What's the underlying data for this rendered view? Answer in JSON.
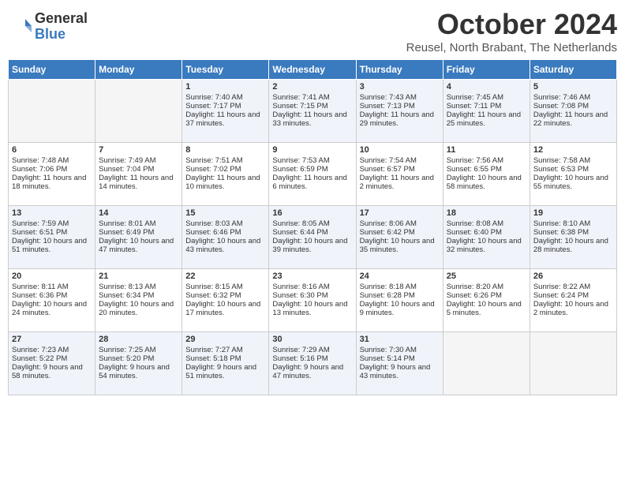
{
  "logo": {
    "general": "General",
    "blue": "Blue"
  },
  "title": "October 2024",
  "location": "Reusel, North Brabant, The Netherlands",
  "days": [
    "Sunday",
    "Monday",
    "Tuesday",
    "Wednesday",
    "Thursday",
    "Friday",
    "Saturday"
  ],
  "weeks": [
    [
      {
        "day": "",
        "empty": true
      },
      {
        "day": "",
        "empty": true
      },
      {
        "day": "1",
        "sunrise": "Sunrise: 7:40 AM",
        "sunset": "Sunset: 7:17 PM",
        "daylight": "Daylight: 11 hours and 37 minutes."
      },
      {
        "day": "2",
        "sunrise": "Sunrise: 7:41 AM",
        "sunset": "Sunset: 7:15 PM",
        "daylight": "Daylight: 11 hours and 33 minutes."
      },
      {
        "day": "3",
        "sunrise": "Sunrise: 7:43 AM",
        "sunset": "Sunset: 7:13 PM",
        "daylight": "Daylight: 11 hours and 29 minutes."
      },
      {
        "day": "4",
        "sunrise": "Sunrise: 7:45 AM",
        "sunset": "Sunset: 7:11 PM",
        "daylight": "Daylight: 11 hours and 25 minutes."
      },
      {
        "day": "5",
        "sunrise": "Sunrise: 7:46 AM",
        "sunset": "Sunset: 7:08 PM",
        "daylight": "Daylight: 11 hours and 22 minutes."
      }
    ],
    [
      {
        "day": "6",
        "sunrise": "Sunrise: 7:48 AM",
        "sunset": "Sunset: 7:06 PM",
        "daylight": "Daylight: 11 hours and 18 minutes."
      },
      {
        "day": "7",
        "sunrise": "Sunrise: 7:49 AM",
        "sunset": "Sunset: 7:04 PM",
        "daylight": "Daylight: 11 hours and 14 minutes."
      },
      {
        "day": "8",
        "sunrise": "Sunrise: 7:51 AM",
        "sunset": "Sunset: 7:02 PM",
        "daylight": "Daylight: 11 hours and 10 minutes."
      },
      {
        "day": "9",
        "sunrise": "Sunrise: 7:53 AM",
        "sunset": "Sunset: 6:59 PM",
        "daylight": "Daylight: 11 hours and 6 minutes."
      },
      {
        "day": "10",
        "sunrise": "Sunrise: 7:54 AM",
        "sunset": "Sunset: 6:57 PM",
        "daylight": "Daylight: 11 hours and 2 minutes."
      },
      {
        "day": "11",
        "sunrise": "Sunrise: 7:56 AM",
        "sunset": "Sunset: 6:55 PM",
        "daylight": "Daylight: 10 hours and 58 minutes."
      },
      {
        "day": "12",
        "sunrise": "Sunrise: 7:58 AM",
        "sunset": "Sunset: 6:53 PM",
        "daylight": "Daylight: 10 hours and 55 minutes."
      }
    ],
    [
      {
        "day": "13",
        "sunrise": "Sunrise: 7:59 AM",
        "sunset": "Sunset: 6:51 PM",
        "daylight": "Daylight: 10 hours and 51 minutes."
      },
      {
        "day": "14",
        "sunrise": "Sunrise: 8:01 AM",
        "sunset": "Sunset: 6:49 PM",
        "daylight": "Daylight: 10 hours and 47 minutes."
      },
      {
        "day": "15",
        "sunrise": "Sunrise: 8:03 AM",
        "sunset": "Sunset: 6:46 PM",
        "daylight": "Daylight: 10 hours and 43 minutes."
      },
      {
        "day": "16",
        "sunrise": "Sunrise: 8:05 AM",
        "sunset": "Sunset: 6:44 PM",
        "daylight": "Daylight: 10 hours and 39 minutes."
      },
      {
        "day": "17",
        "sunrise": "Sunrise: 8:06 AM",
        "sunset": "Sunset: 6:42 PM",
        "daylight": "Daylight: 10 hours and 35 minutes."
      },
      {
        "day": "18",
        "sunrise": "Sunrise: 8:08 AM",
        "sunset": "Sunset: 6:40 PM",
        "daylight": "Daylight: 10 hours and 32 minutes."
      },
      {
        "day": "19",
        "sunrise": "Sunrise: 8:10 AM",
        "sunset": "Sunset: 6:38 PM",
        "daylight": "Daylight: 10 hours and 28 minutes."
      }
    ],
    [
      {
        "day": "20",
        "sunrise": "Sunrise: 8:11 AM",
        "sunset": "Sunset: 6:36 PM",
        "daylight": "Daylight: 10 hours and 24 minutes."
      },
      {
        "day": "21",
        "sunrise": "Sunrise: 8:13 AM",
        "sunset": "Sunset: 6:34 PM",
        "daylight": "Daylight: 10 hours and 20 minutes."
      },
      {
        "day": "22",
        "sunrise": "Sunrise: 8:15 AM",
        "sunset": "Sunset: 6:32 PM",
        "daylight": "Daylight: 10 hours and 17 minutes."
      },
      {
        "day": "23",
        "sunrise": "Sunrise: 8:16 AM",
        "sunset": "Sunset: 6:30 PM",
        "daylight": "Daylight: 10 hours and 13 minutes."
      },
      {
        "day": "24",
        "sunrise": "Sunrise: 8:18 AM",
        "sunset": "Sunset: 6:28 PM",
        "daylight": "Daylight: 10 hours and 9 minutes."
      },
      {
        "day": "25",
        "sunrise": "Sunrise: 8:20 AM",
        "sunset": "Sunset: 6:26 PM",
        "daylight": "Daylight: 10 hours and 5 minutes."
      },
      {
        "day": "26",
        "sunrise": "Sunrise: 8:22 AM",
        "sunset": "Sunset: 6:24 PM",
        "daylight": "Daylight: 10 hours and 2 minutes."
      }
    ],
    [
      {
        "day": "27",
        "sunrise": "Sunrise: 7:23 AM",
        "sunset": "Sunset: 5:22 PM",
        "daylight": "Daylight: 9 hours and 58 minutes."
      },
      {
        "day": "28",
        "sunrise": "Sunrise: 7:25 AM",
        "sunset": "Sunset: 5:20 PM",
        "daylight": "Daylight: 9 hours and 54 minutes."
      },
      {
        "day": "29",
        "sunrise": "Sunrise: 7:27 AM",
        "sunset": "Sunset: 5:18 PM",
        "daylight": "Daylight: 9 hours and 51 minutes."
      },
      {
        "day": "30",
        "sunrise": "Sunrise: 7:29 AM",
        "sunset": "Sunset: 5:16 PM",
        "daylight": "Daylight: 9 hours and 47 minutes."
      },
      {
        "day": "31",
        "sunrise": "Sunrise: 7:30 AM",
        "sunset": "Sunset: 5:14 PM",
        "daylight": "Daylight: 9 hours and 43 minutes."
      },
      {
        "day": "",
        "empty": true
      },
      {
        "day": "",
        "empty": true
      }
    ]
  ]
}
